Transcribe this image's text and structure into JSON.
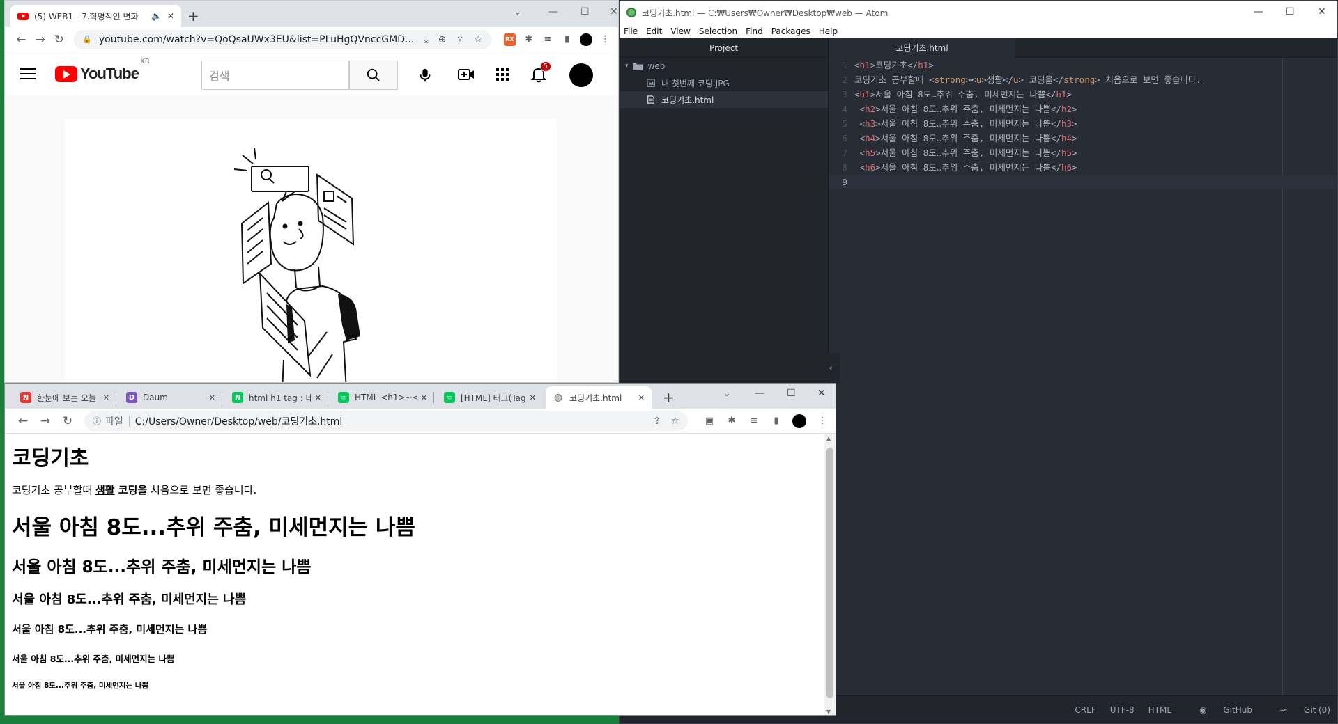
{
  "youtube_window": {
    "tab_title": "(5) WEB1 - 7.혁명적인 변화",
    "address": "youtube.com/watch?v=QoQsaUWx3EU&list=PLuHgQVnccGMD...",
    "logo_text": "YouTube",
    "region": "KR",
    "search_placeholder": "검색",
    "notification_count": "5"
  },
  "atom_window": {
    "title": "코딩기초.html — C:₩Users₩Owner₩Desktop₩web — Atom",
    "menu": [
      "File",
      "Edit",
      "View",
      "Selection",
      "Find",
      "Packages",
      "Help"
    ],
    "tree_header": "Project",
    "folder": "web",
    "files": [
      "내 첫번째 코딩.JPG",
      "코딩기초.html"
    ],
    "editor_tab": "코딩기초.html",
    "code_lines": [
      {
        "n": "1",
        "text": "<h1>코딩기초</h1>"
      },
      {
        "n": "2",
        "text": "코딩기초 공부할때 <strong><u>생활</u> 코딩을</strong> 처음으로 보면 좋습니다."
      },
      {
        "n": "3",
        "text": "<h1>서울 아침 8도…추위 주춤, 미세먼지는 나쁨</h1>"
      },
      {
        "n": "4",
        "text": " <h2>서울 아침 8도…추위 주춤, 미세먼지는 나쁨</h2>"
      },
      {
        "n": "5",
        "text": " <h3>서울 아침 8도…추위 주춤, 미세먼지는 나쁨</h3>"
      },
      {
        "n": "6",
        "text": " <h4>서울 아침 8도…추위 주춤, 미세먼지는 나쁨</h4>"
      },
      {
        "n": "7",
        "text": " <h5>서울 아침 8도…추위 주춤, 미세먼지는 나쁨</h5>"
      },
      {
        "n": "8",
        "text": " <h6>서울 아침 8도…추위 주춤, 미세먼지는 나쁨</h6>"
      },
      {
        "n": "9",
        "text": ""
      }
    ],
    "status": {
      "line_ending": "CRLF",
      "encoding": "UTF-8",
      "grammar": "HTML",
      "github": "GitHub",
      "git": "Git (0)"
    }
  },
  "local_window": {
    "tabs": [
      {
        "title": "한눈에 보는 오늘",
        "fav": "N",
        "color": "#e53935"
      },
      {
        "title": "Daum",
        "fav": "D",
        "color": "#7e57c2"
      },
      {
        "title": "html h1 tag : 네이",
        "fav": "N",
        "color": "#03c75a"
      },
      {
        "title": "HTML <h1>~<h",
        "fav": "▭",
        "color": "#03c75a"
      },
      {
        "title": "[HTML] 태그(Tag",
        "fav": "▭",
        "color": "#03c75a"
      },
      {
        "title": "코딩기초.html",
        "fav": "◍",
        "color": "#5f6368"
      }
    ],
    "file_label": "파일",
    "address": "C:/Users/Owner/Desktop/web/코딩기초.html",
    "page": {
      "h1": "코딩기초",
      "p_before": "코딩기초 공부할때 ",
      "p_underlined": "생활",
      "p_strong_rest": " 코딩을",
      "p_after": " 처음으로 보면 좋습니다.",
      "headline": "서울 아침 8도...추위 주춤, 미세먼지는 나쁨"
    }
  }
}
